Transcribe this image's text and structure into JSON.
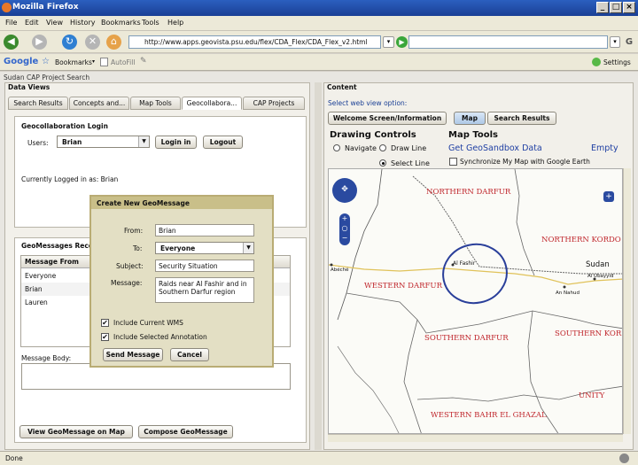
{
  "window": {
    "title": "Mozilla Firefox",
    "min": "_",
    "max": "□",
    "close": "×"
  },
  "menu": [
    "File",
    "Edit",
    "View",
    "History",
    "Bookmarks",
    "Tools",
    "Help"
  ],
  "nav": {
    "url": "http://www.apps.geovista.psu.edu/flex/CDA_Flex/CDA_Flex_v2.html",
    "search_engine": "G"
  },
  "gbar": {
    "google": "Google",
    "bookmarks": "Bookmarks",
    "autofill": "AutoFill",
    "settings": "Settings"
  },
  "app": {
    "title": "Sudan CAP Project Search",
    "data_views": "Data Views",
    "content": "Content"
  },
  "tabs": [
    "Search Results",
    "Concepts and...",
    "Map Tools",
    "Geocollabora...",
    "CAP Projects"
  ],
  "login": {
    "title": "Geocollaboration Login",
    "users_label": "Users:",
    "user": "Brian",
    "login_btn": "Login in",
    "logout_btn": "Logout",
    "status": "Currently Logged in as: Brian"
  },
  "messages": {
    "title": "GeoMessages Recei",
    "col_header": "Message From",
    "rows": [
      "Everyone",
      "Brian",
      "Lauren"
    ],
    "body_label": "Message Body:",
    "view_btn": "View GeoMessage on Map",
    "compose_btn": "Compose GeoMessage"
  },
  "dialog": {
    "title": "Create New GeoMessage",
    "from_label": "From:",
    "from": "Brian",
    "to_label": "To:",
    "to": "Everyone",
    "subject_label": "Subject:",
    "subject": "Security Situation",
    "message_label": "Message:",
    "message": "Raids near Al Fashir and in Southern Darfur region",
    "wms": "Include Current WMS",
    "annotation": "Include Selected Annotation",
    "send": "Send Message",
    "cancel": "Cancel"
  },
  "content": {
    "select_label": "Select web view option:",
    "view_btns": [
      "Welcome Screen/Information",
      "Map",
      "Search Results"
    ],
    "drawing_title": "Drawing Controls",
    "navigate": "Navigate",
    "draw_line": "Draw Line",
    "select_line": "Select Line",
    "maptools_title": "Map Tools",
    "get_geo": "Get GeoSandbox Data",
    "empty": "Empty",
    "sync": "Synchronize My Map with Google Earth"
  },
  "map_labels": {
    "north_darfur": "NORTHERN DARFUR",
    "north_kordofan": "NORTHERN KORDO",
    "west_darfur": "WESTERN DARFUR",
    "south_darfur": "SOUTHERN DARFUR",
    "south_kordofan": "SOUTHERN KOR",
    "unity": "UNITY",
    "west_bahr": "WESTERN BAHR EL GHAZAL",
    "sudan": "Sudan",
    "al_fashir": "Al Fashir",
    "abeche": "Abéché",
    "al_ubayyid": "Al Ubayyid",
    "an_nahud": "An Nahud"
  },
  "status": "Done"
}
